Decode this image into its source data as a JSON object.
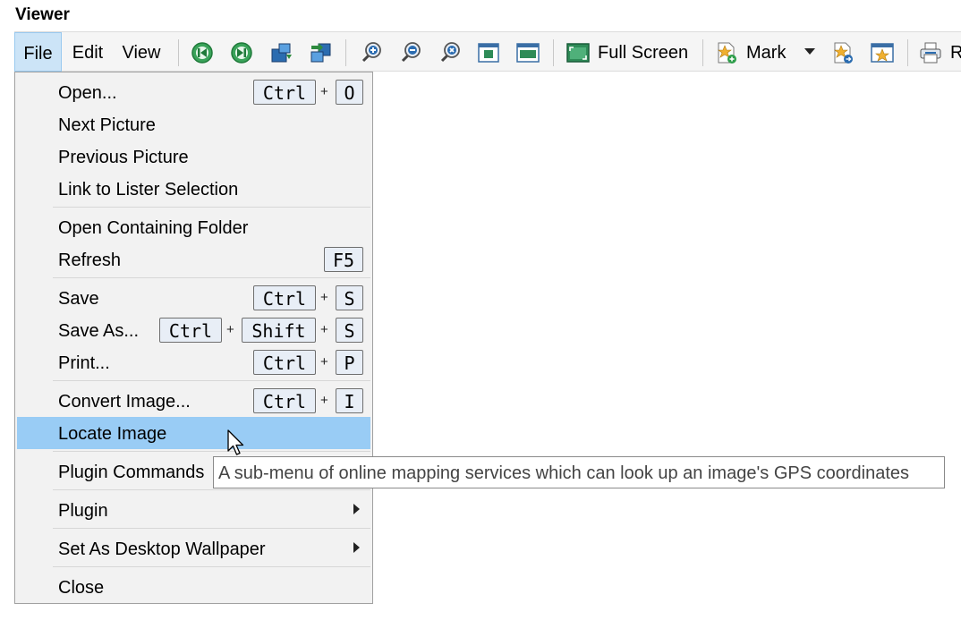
{
  "window": {
    "title": "Viewer"
  },
  "menubar": {
    "file": "File",
    "edit": "Edit",
    "view": "View"
  },
  "toolbar": {
    "full_screen_label": "Full Screen",
    "mark_label": "Mark",
    "truncated_label": "R",
    "icons": [
      "previous-icon",
      "next-icon",
      "move-image-icon",
      "copy-image-icon",
      "zoom-in-icon",
      "zoom-out-icon",
      "zoom-reset-icon",
      "fit-window-icon",
      "fit-width-icon",
      "full-screen-icon",
      "mark-add-icon",
      "mark-dropdown-icon",
      "mark-goto-icon",
      "mark-star-icon",
      "print-icon"
    ]
  },
  "file_menu": {
    "open": {
      "label": "Open...",
      "keys": [
        "Ctrl",
        "O"
      ]
    },
    "next_picture": {
      "label": "Next Picture"
    },
    "previous_picture": {
      "label": "Previous Picture"
    },
    "link_lister": {
      "label": "Link to Lister Selection"
    },
    "open_folder": {
      "label": "Open Containing Folder"
    },
    "refresh": {
      "label": "Refresh",
      "keys": [
        "F5"
      ]
    },
    "save": {
      "label": "Save",
      "keys": [
        "Ctrl",
        "S"
      ]
    },
    "save_as": {
      "label": "Save As...",
      "keys": [
        "Ctrl",
        "Shift",
        "S"
      ]
    },
    "print": {
      "label": "Print...",
      "keys": [
        "Ctrl",
        "P"
      ]
    },
    "convert": {
      "label": "Convert Image...",
      "keys": [
        "Ctrl",
        "I"
      ]
    },
    "locate": {
      "label": "Locate Image"
    },
    "plugin_commands": {
      "label": "Plugin Commands"
    },
    "plugin": {
      "label": "Plugin"
    },
    "wallpaper": {
      "label": "Set As Desktop Wallpaper"
    },
    "close": {
      "label": "Close"
    },
    "plus_sign": "+"
  },
  "tooltip": {
    "text": "A sub-menu of online mapping services which can look up an image's GPS coordinates"
  },
  "colors": {
    "highlight": "#99ccf5",
    "menu_bg": "#f2f2f2",
    "key_bg": "#e8eef6",
    "file_active": "#cce4f7"
  }
}
